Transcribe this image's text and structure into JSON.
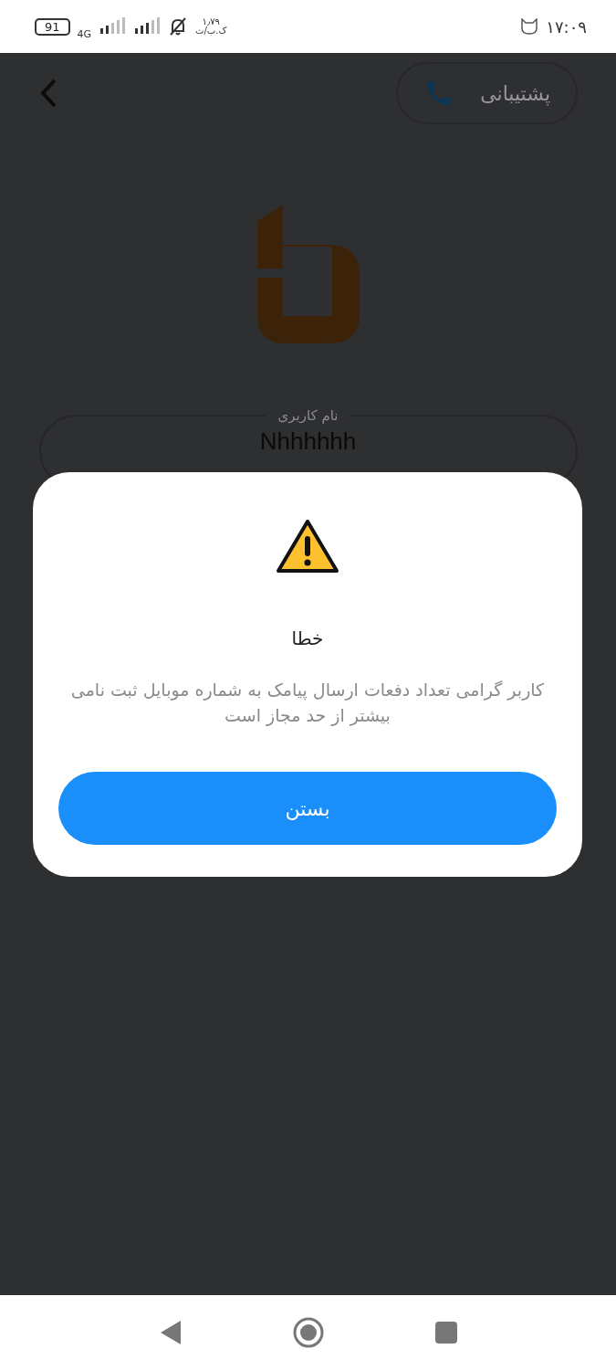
{
  "status_bar": {
    "battery": "91",
    "network": "4G",
    "data_speed": "۱٫۷۹",
    "data_unit": "ک.ب/ث",
    "time": "۱۷:۰۹"
  },
  "header": {
    "support_button": "پشتیبانی"
  },
  "username_field": {
    "label": "نام کاربری",
    "value": "Nhhhhhh"
  },
  "dialog": {
    "title": "خطا",
    "message": "کاربر گرامی تعداد دفعات ارسال پیامک به شماره موبایل ثبت نامی بیشتر از حد مجاز است",
    "button": "بستن"
  }
}
